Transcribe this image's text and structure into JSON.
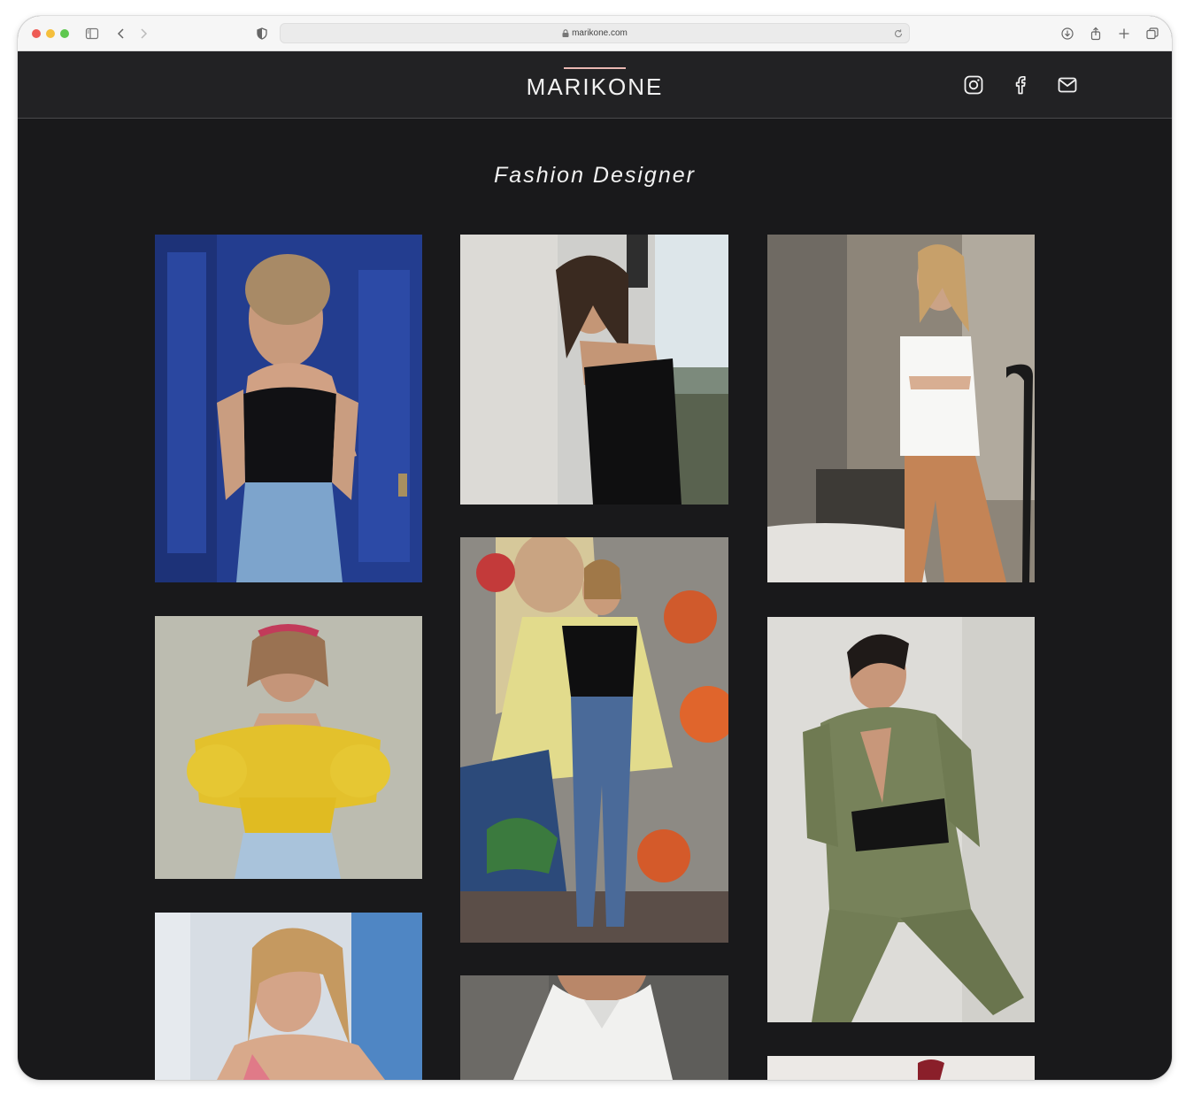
{
  "browser": {
    "url": "marikone.com"
  },
  "site": {
    "logo": "MARIKONE",
    "social": [
      "instagram-icon",
      "facebook-icon",
      "mail-icon"
    ],
    "accent_color": "#e9b8b2"
  },
  "main": {
    "title": "Fashion Designer"
  },
  "gallery": {
    "photos": [
      "woman-black-bustier-blue-door",
      "woman-black-corset-window",
      "woman-white-shirt-tan-trousers",
      "woman-yellow-off-shoulder-top",
      "woman-mural-black-top-jeans",
      "woman-green-suit-corset-belt",
      "woman-floral-top-blue-wall",
      "person-white-shirt",
      "partial-photo-bottom-right"
    ]
  }
}
